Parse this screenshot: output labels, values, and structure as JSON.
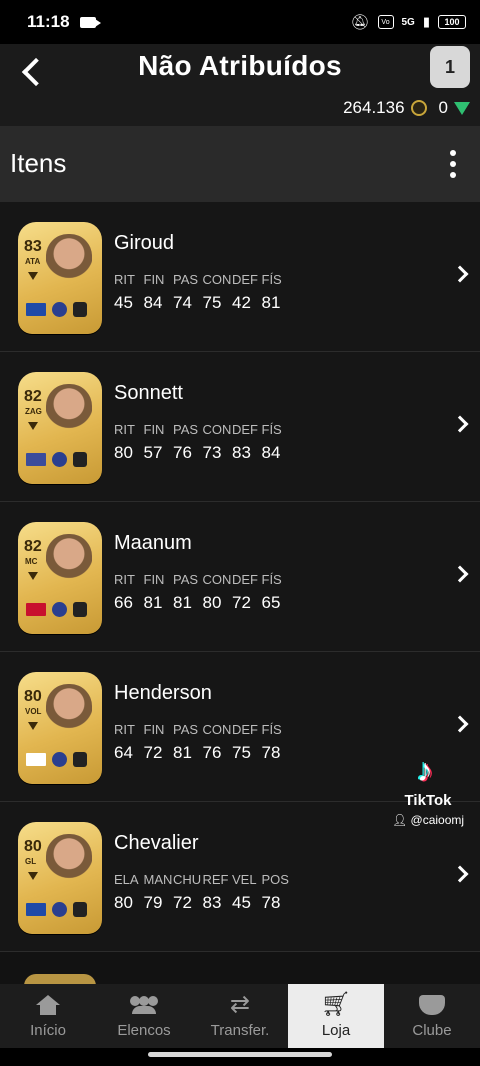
{
  "status_bar": {
    "time": "11:18",
    "network": "5G",
    "battery": "100"
  },
  "header": {
    "title": "Não Atribuídos",
    "badge_label": "1",
    "coins": "264.136",
    "points": "0"
  },
  "section": {
    "label": "Itens"
  },
  "players": [
    {
      "rating": "83",
      "position": "ATA",
      "name": "Giroud",
      "stat_labels": [
        "RIT",
        "FIN",
        "PAS",
        "CON",
        "DEF",
        "FÍS"
      ],
      "stat_values": [
        "45",
        "84",
        "74",
        "75",
        "42",
        "81"
      ],
      "flag_color": "#1f4aa8"
    },
    {
      "rating": "82",
      "position": "ZAG",
      "name": "Sonnett",
      "stat_labels": [
        "RIT",
        "FIN",
        "PAS",
        "CON",
        "DEF",
        "FÍS"
      ],
      "stat_values": [
        "80",
        "57",
        "76",
        "73",
        "83",
        "84"
      ],
      "flag_color": "#3b4c9b"
    },
    {
      "rating": "82",
      "position": "MC",
      "name": "Maanum",
      "stat_labels": [
        "RIT",
        "FIN",
        "PAS",
        "CON",
        "DEF",
        "FÍS"
      ],
      "stat_values": [
        "66",
        "81",
        "81",
        "80",
        "72",
        "65"
      ],
      "flag_color": "#c8102e"
    },
    {
      "rating": "80",
      "position": "VOL",
      "name": "Henderson",
      "stat_labels": [
        "RIT",
        "FIN",
        "PAS",
        "CON",
        "DEF",
        "FÍS"
      ],
      "stat_values": [
        "64",
        "72",
        "81",
        "76",
        "75",
        "78"
      ],
      "flag_color": "#ffffff"
    },
    {
      "rating": "80",
      "position": "GL",
      "name": "Chevalier",
      "stat_labels": [
        "ELA",
        "MAN",
        "CHU",
        "REF",
        "VEL",
        "POS"
      ],
      "stat_values": [
        "80",
        "79",
        "72",
        "83",
        "45",
        "78"
      ],
      "flag_color": "#1f4aa8"
    }
  ],
  "watermark": {
    "name": "TikTok",
    "user": "@caioomj"
  },
  "bottom_nav": [
    {
      "label": "Início",
      "icon": "home-icon"
    },
    {
      "label": "Elencos",
      "icon": "people-icon"
    },
    {
      "label": "Transfer.",
      "icon": "swap-icon"
    },
    {
      "label": "Loja",
      "icon": "cart-icon",
      "active": true
    },
    {
      "label": "Clube",
      "icon": "club-icon"
    }
  ]
}
